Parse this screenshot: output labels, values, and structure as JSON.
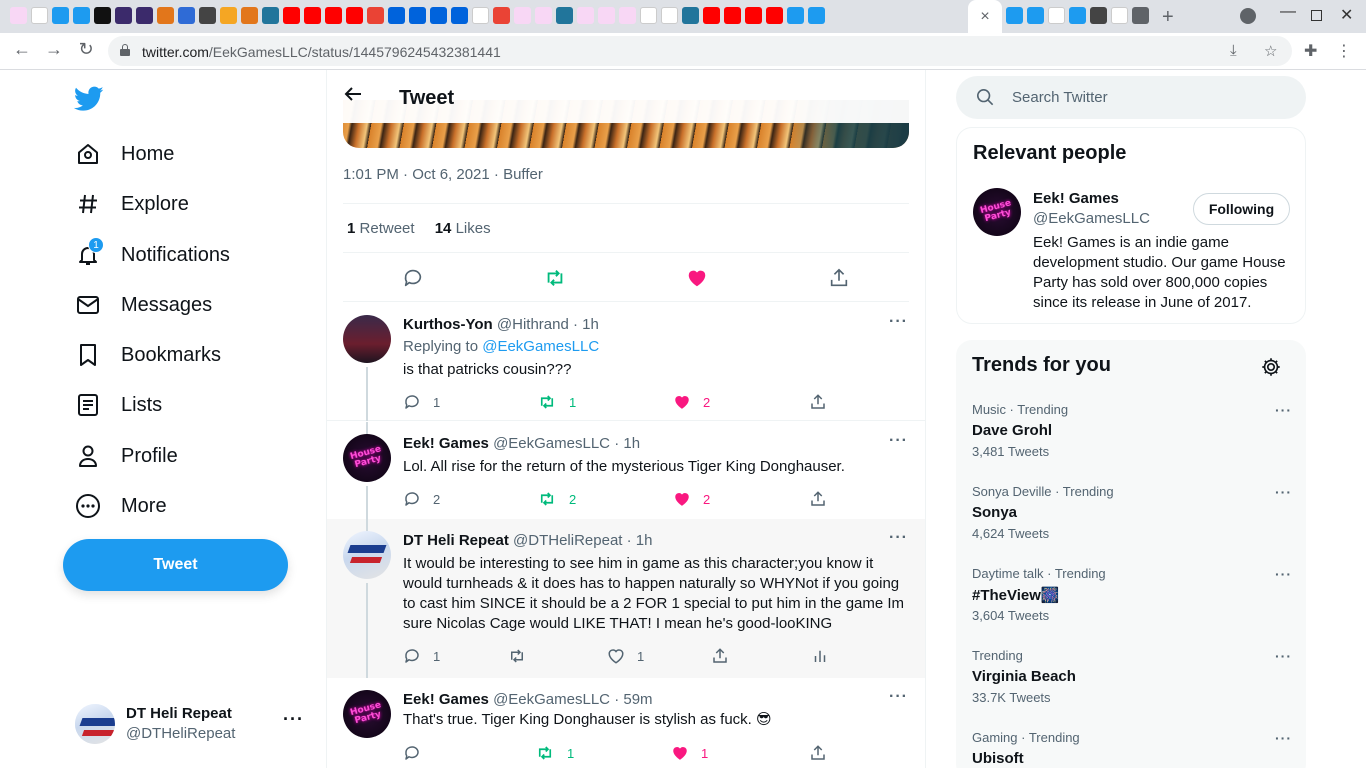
{
  "browser": {
    "tab_favicons": [
      {
        "icon": "heart-favicon",
        "color": "#f8d7f5"
      },
      {
        "icon": "google-favicon",
        "color": "#ffffff"
      },
      {
        "icon": "twitter-favicon",
        "color": "#1d9bf0"
      },
      {
        "icon": "twitter-favicon",
        "color": "#1d9bf0"
      },
      {
        "icon": "coin-favicon",
        "color": "#111111"
      },
      {
        "icon": "eth-favicon",
        "color": "#3b2a6b"
      },
      {
        "icon": "eth-favicon",
        "color": "#3b2a6b"
      },
      {
        "icon": "fox-favicon",
        "color": "#e2761b"
      },
      {
        "icon": "circle-favicon",
        "color": "#2f6bd6"
      },
      {
        "icon": "search-favicon",
        "color": "#444444"
      },
      {
        "icon": "rainbow-favicon",
        "color": "#f5a623"
      },
      {
        "icon": "fox-favicon",
        "color": "#e2761b"
      },
      {
        "icon": "wordpress-favicon",
        "color": "#21759b"
      },
      {
        "icon": "youtube-favicon",
        "color": "#ff0000"
      },
      {
        "icon": "youtube-favicon",
        "color": "#ff0000"
      },
      {
        "icon": "youtube-favicon",
        "color": "#ff0000"
      },
      {
        "icon": "youtube-favicon",
        "color": "#ff0000"
      },
      {
        "icon": "gmail-favicon",
        "color": "#ea4335"
      },
      {
        "icon": "flickr-favicon",
        "color": "#0063dc"
      },
      {
        "icon": "flickr-favicon",
        "color": "#0063dc"
      },
      {
        "icon": "flickr-favicon",
        "color": "#0063dc"
      },
      {
        "icon": "flickr-favicon",
        "color": "#0063dc"
      },
      {
        "icon": "google-favicon",
        "color": "#ffffff"
      },
      {
        "icon": "gmail-favicon",
        "color": "#ea4335"
      },
      {
        "icon": "heart-favicon",
        "color": "#f8d7f5"
      },
      {
        "icon": "heart-favicon",
        "color": "#f8d7f5"
      },
      {
        "icon": "wordpress-favicon",
        "color": "#21759b"
      },
      {
        "icon": "heart-favicon",
        "color": "#f8d7f5"
      },
      {
        "icon": "heart-favicon",
        "color": "#f8d7f5"
      },
      {
        "icon": "heart-favicon",
        "color": "#f8d7f5"
      },
      {
        "icon": "google-favicon",
        "color": "#ffffff"
      },
      {
        "icon": "google-favicon",
        "color": "#ffffff"
      },
      {
        "icon": "wordpress-favicon",
        "color": "#21759b"
      },
      {
        "icon": "youtube-favicon",
        "color": "#ff0000"
      },
      {
        "icon": "youtube-favicon",
        "color": "#ff0000"
      },
      {
        "icon": "youtube-favicon",
        "color": "#ff0000"
      },
      {
        "icon": "youtube-favicon",
        "color": "#ff0000"
      },
      {
        "icon": "twitter-favicon",
        "color": "#1d9bf0"
      },
      {
        "icon": "twitter-favicon",
        "color": "#1d9bf0"
      }
    ],
    "active_tab_close": "×",
    "right_tab_favicons": [
      {
        "icon": "twitter-favicon",
        "color": "#1d9bf0"
      },
      {
        "icon": "twitter-favicon",
        "color": "#1d9bf0"
      },
      {
        "icon": "google-favicon",
        "color": "#ffffff"
      },
      {
        "icon": "twitter-favicon",
        "color": "#1d9bf0"
      },
      {
        "icon": "github-favicon",
        "color": "#444444"
      },
      {
        "icon": "google-favicon",
        "color": "#ffffff"
      },
      {
        "icon": "chrome-favicon",
        "color": "#5f6368"
      }
    ],
    "new_tab": "+",
    "url_host": "twitter.com",
    "url_path": "/EekGamesLLC/status/1445796245432381441"
  },
  "sidebar": {
    "items": [
      {
        "label": "Home",
        "icon": "home-icon"
      },
      {
        "label": "Explore",
        "icon": "hashtag-icon"
      },
      {
        "label": "Notifications",
        "icon": "bell-icon",
        "badge": "1"
      },
      {
        "label": "Messages",
        "icon": "envelope-icon"
      },
      {
        "label": "Bookmarks",
        "icon": "bookmark-icon"
      },
      {
        "label": "Lists",
        "icon": "list-icon"
      },
      {
        "label": "Profile",
        "icon": "person-icon"
      },
      {
        "label": "More",
        "icon": "more-circle-icon"
      }
    ],
    "tweet_button": "Tweet",
    "account": {
      "name": "DT Heli Repeat",
      "handle": "@DTHeliRepeat",
      "more": "···"
    }
  },
  "main": {
    "title": "Tweet",
    "meta": "1:01 PM · Oct 6, 2021 · Buffer",
    "stats": {
      "retweets_count": "1",
      "retweets_label": "Retweet",
      "likes_count": "14",
      "likes_label": "Likes"
    },
    "replies": [
      {
        "name": "Kurthos-Yon",
        "handle": "@Hithrand",
        "time": "· 1h",
        "replying_prefix": "Replying to",
        "replying_to": "@EekGamesLLC",
        "text": "is that patricks cousin???",
        "replies": "1",
        "retweets": "1",
        "likes": "2",
        "liked": true,
        "retweeted": true
      },
      {
        "name": "Eek! Games",
        "handle": "@EekGamesLLC",
        "time": "· 1h",
        "text": "Lol. All rise for the return of the mysterious Tiger King Donghauser.",
        "replies": "2",
        "retweets": "2",
        "likes": "2",
        "liked": true,
        "retweeted": true
      },
      {
        "name": "DT Heli Repeat",
        "handle": "@DTHeliRepeat",
        "time": "· 1h",
        "text": "It would be interesting to see him in game as this character;you know it would turnheads & it does has to happen naturally so WHYNot if you going to cast him SINCE it should be a 2 FOR 1 special to put him in the game Im sure Nicolas Cage would LIKE THAT! I mean he's good-looKING",
        "replies": "1",
        "retweets": "",
        "likes": "1",
        "liked": false,
        "retweeted": false
      },
      {
        "name": "Eek! Games",
        "handle": "@EekGamesLLC",
        "time": "· 59m",
        "text": "That's true. Tiger King Donghauser is stylish as fuck. 😎",
        "replies": "",
        "retweets": "1",
        "likes": "1",
        "liked": true,
        "retweeted": true
      }
    ]
  },
  "right": {
    "search_placeholder": "Search Twitter",
    "relevant": {
      "title": "Relevant people",
      "name": "Eek! Games",
      "handle": "@EekGamesLLC",
      "follow_label": "Following",
      "bio": "Eek! Games is an indie game development studio. Our game House Party has sold over 800,000 copies since its release in June of 2017."
    },
    "trends": {
      "title": "Trends for you",
      "items": [
        {
          "context": "Music · Trending",
          "name": "Dave Grohl",
          "count": "3,481 Tweets"
        },
        {
          "context": "Sonya Deville · Trending",
          "name": "Sonya",
          "count": "4,624 Tweets"
        },
        {
          "context": "Daytime talk · Trending",
          "name": "#TheView🎆",
          "count": "3,604 Tweets"
        },
        {
          "context": "Trending",
          "name": "Virginia Beach",
          "count": "33.7K Tweets"
        },
        {
          "context": "Gaming · Trending",
          "name": "Ubisoft",
          "count": ""
        }
      ]
    }
  },
  "avatar_art": {
    "house_party": "House Party"
  },
  "colors": {
    "twitter_blue": "#1d9bf0",
    "like_pink": "#f91880",
    "retweet_green": "#00ba7c"
  }
}
